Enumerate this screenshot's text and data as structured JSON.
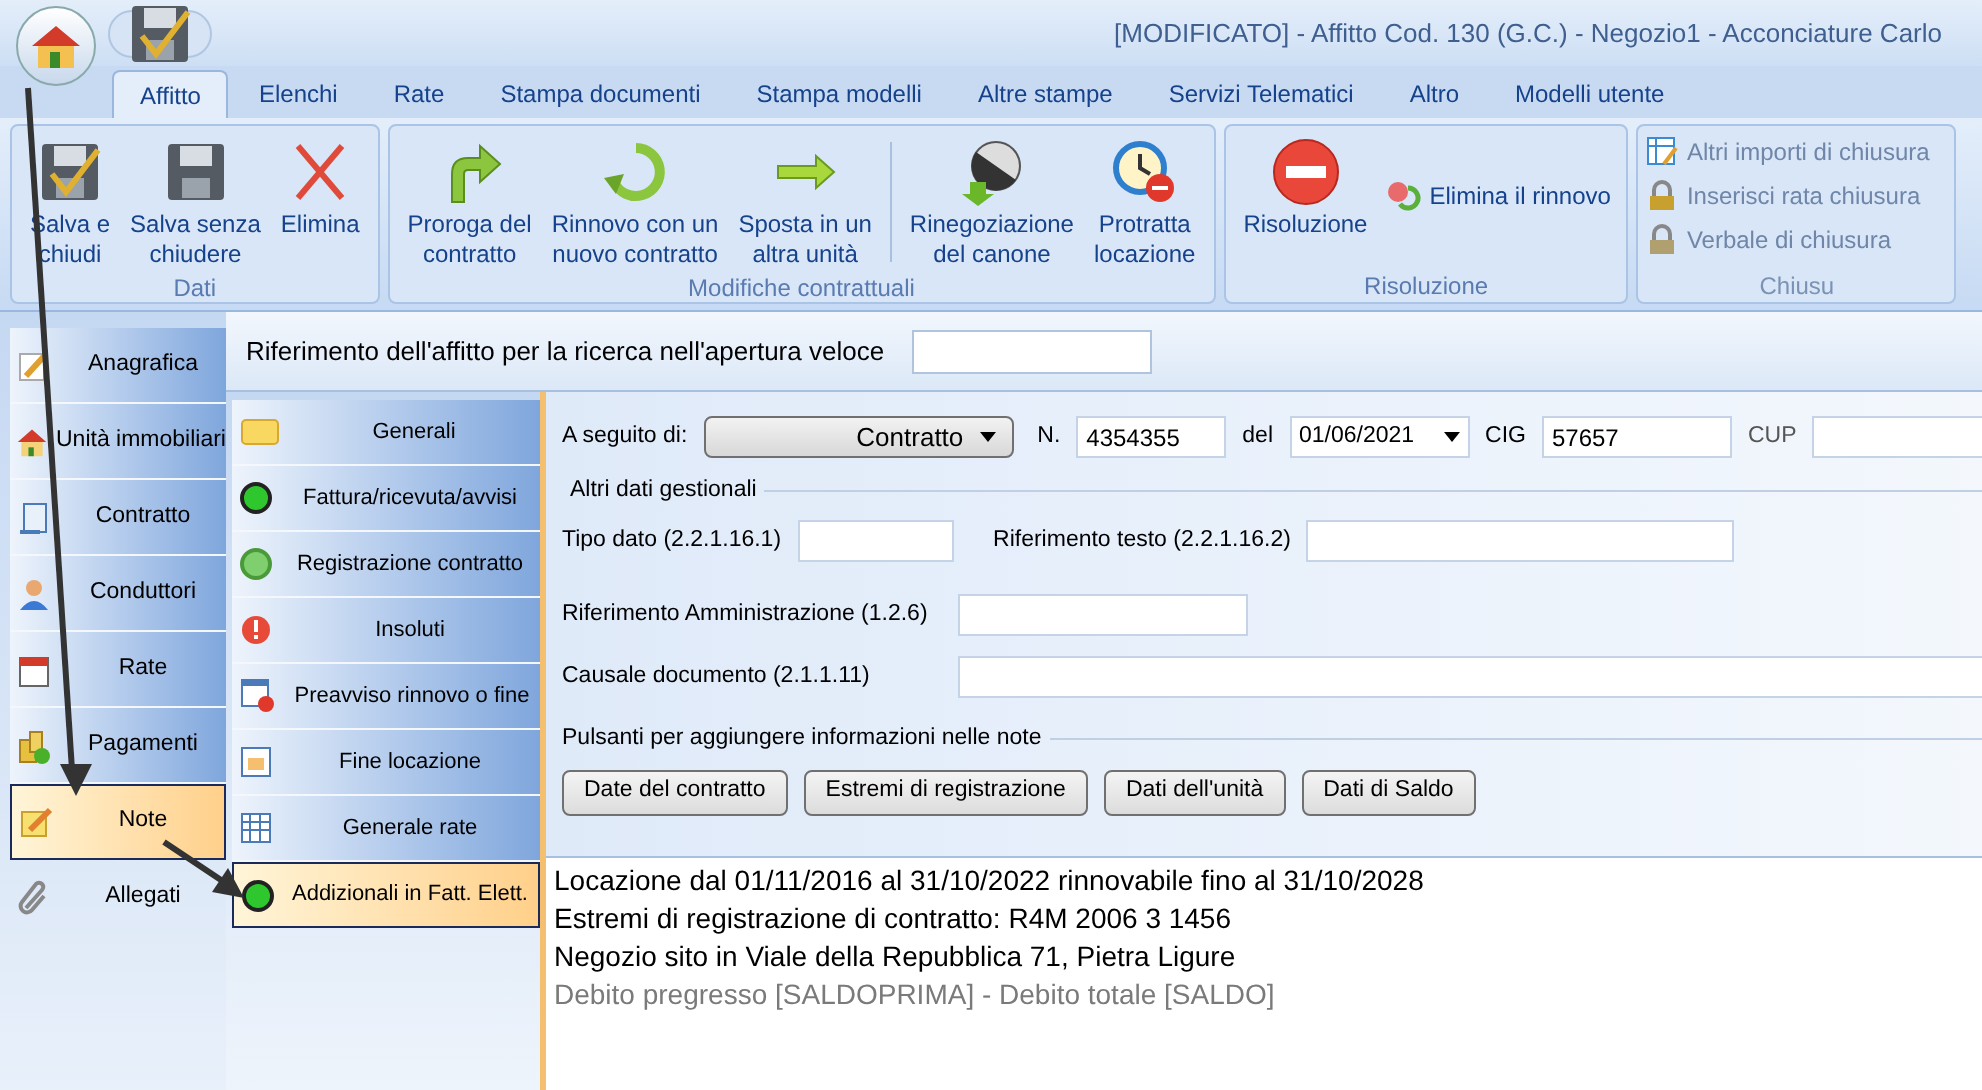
{
  "window": {
    "title": "[MODIFICATO] - Affitto Cod. 130 (G.C.) - Negozio1 - Acconciature Carlo"
  },
  "ribbon_tabs": [
    {
      "label": "Affitto",
      "selected": true
    },
    {
      "label": "Elenchi",
      "selected": false
    },
    {
      "label": "Rate",
      "selected": false
    },
    {
      "label": "Stampa documenti",
      "selected": false
    },
    {
      "label": "Stampa modelli",
      "selected": false
    },
    {
      "label": "Altre stampe",
      "selected": false
    },
    {
      "label": "Servizi Telematici",
      "selected": false
    },
    {
      "label": "Altro",
      "selected": false
    },
    {
      "label": "Modelli utente",
      "selected": false
    }
  ],
  "ribbon_groups": [
    {
      "label": "Dati",
      "buttons": [
        {
          "kind": "large",
          "lines": [
            "Salva e",
            "chiudi"
          ],
          "disabled": false
        },
        {
          "kind": "large",
          "lines": [
            "Salva senza",
            "chiudere"
          ],
          "disabled": false
        },
        {
          "kind": "large",
          "lines": [
            "Elimina"
          ],
          "disabled": false
        }
      ]
    },
    {
      "label": "Modifiche contrattuali",
      "buttons": [
        {
          "kind": "large",
          "lines": [
            "Proroga del",
            "contratto"
          ],
          "disabled": false
        },
        {
          "kind": "large",
          "lines": [
            "Rinnovo con un",
            "nuovo contratto"
          ],
          "disabled": false
        },
        {
          "kind": "large",
          "lines": [
            "Sposta in un",
            "altra unità"
          ],
          "disabled": false
        },
        {
          "kind": "separator"
        },
        {
          "kind": "large",
          "lines": [
            "Rinegoziazione",
            "del canone"
          ],
          "disabled": false
        },
        {
          "kind": "large",
          "lines": [
            "Protratta",
            "locazione"
          ],
          "disabled": false
        }
      ]
    },
    {
      "label": "Risoluzione",
      "buttons": [
        {
          "kind": "large",
          "lines": [
            "Risoluzione"
          ],
          "disabled": false
        },
        {
          "kind": "small",
          "lines": [
            "Elimina il rinnovo"
          ],
          "disabled": false
        }
      ]
    },
    {
      "label": "Chiusu",
      "buttons": [
        {
          "kind": "stack",
          "items": [
            {
              "label": "Altri importi di chiusura",
              "disabled": true
            },
            {
              "label": "Inserisci rata chiusura",
              "disabled": true
            },
            {
              "label": "Verbale di chiusura",
              "disabled": true
            }
          ]
        }
      ]
    }
  ],
  "quick_reference": {
    "label": "Riferimento dell'affitto per la ricerca nell'apertura veloce"
  },
  "sidebar": {
    "items": [
      {
        "label": "Anagrafica",
        "selected": false
      },
      {
        "label": "Unità immobiliari",
        "selected": false
      },
      {
        "label": "Contratto",
        "selected": false
      },
      {
        "label": "Conduttori",
        "selected": false
      },
      {
        "label": "Rate",
        "selected": false
      },
      {
        "label": "Pagamenti",
        "selected": false
      },
      {
        "label": "Note",
        "selected": true
      },
      {
        "label": "Allegati",
        "selected": false
      }
    ]
  },
  "subnav": {
    "items": [
      {
        "label": "Generali",
        "selected": false
      },
      {
        "label": "Fattura/ricevuta/avvisi",
        "selected": false
      },
      {
        "label": "Registrazione contratto",
        "selected": false
      },
      {
        "label": "Insoluti",
        "selected": false
      },
      {
        "label": "Preavviso rinnovo o fine",
        "selected": false
      },
      {
        "label": "Fine locazione",
        "selected": false
      },
      {
        "label": "Generale rate",
        "selected": false
      },
      {
        "label": "Addizionali in Fatt. Elett.",
        "selected": true
      }
    ]
  },
  "form": {
    "following": {
      "label": "A seguito di:",
      "value": "Contratto"
    },
    "number": {
      "label": "N.",
      "value": "4354355"
    },
    "date": {
      "label": "del",
      "value": "01/06/2021"
    },
    "cig": {
      "label": "CIG",
      "value": "57657"
    },
    "cup": {
      "label": "CUP"
    },
    "other_data": {
      "title": "Altri dati gestionali",
      "fields": [
        {
          "label": "Tipo dato (2.2.1.16.1)"
        },
        {
          "label": "Riferimento testo (2.2.1.16.2)"
        },
        {
          "label": "Riferimento Amministrazione (1.2.6)"
        },
        {
          "label": "Causale documento (2.1.1.11)"
        }
      ]
    },
    "note_buttons": {
      "title": "Pulsanti per aggiungere informazioni nelle note",
      "buttons": [
        "Date del contratto",
        "Estremi di registrazione",
        "Dati dell'unità",
        "Dati di Saldo"
      ]
    }
  },
  "notes": {
    "lines": [
      {
        "text": "Locazione dal 01/11/2016 al 31/10/2022 rinnovabile fino al 31/10/2028",
        "muted": false
      },
      {
        "text": "Estremi di registrazione di contratto: R4M 2006 3 1456",
        "muted": false
      },
      {
        "text": "Negozio sito in Viale della Repubblica 71, Pietra Ligure",
        "muted": false
      },
      {
        "text": "Debito pregresso [SALDOPRIMA] - Debito totale [SALDO]",
        "muted": true
      }
    ]
  }
}
